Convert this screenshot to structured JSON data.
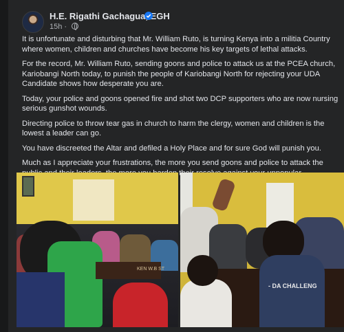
{
  "post": {
    "author": "H.E. Rigathi Gachagua, EGH",
    "time": "15h",
    "paragraphs": [
      "It is unfortunate and disturbing that Mr. William Ruto, is turning Kenya into a militia Country where women, children and churches have become his key targets of lethal attacks.",
      "For the record, Mr. William Ruto, sending goons and police to attack us at the PCEA church, Kariobangi North today, to punish the people of Kariobangi North for rejecting your UDA Candidate shows how desperate you are.",
      "Today, your police and goons opened fire and shot two DCP supporters who are now nursing serious gunshot wounds.",
      "Directing police to throw tear gas in church to harm the clergy, women and children is the lowest a leader can go.",
      "You have discreeted the Altar and defiled a Holy Place and for sure God will punish you.",
      "Much as I appreciate your frustrations, the more you send goons and police to attack the public and their leaders, the more  you harden their resolve against your unpopular leadership."
    ]
  },
  "icons": {
    "verified": "verified-badge-icon",
    "audience": "globe-icon"
  },
  "colors": {
    "background": "#18191a",
    "card": "#242526",
    "text": "#e4e6eb",
    "secondary_text": "#b0b3b8",
    "verified": "#1877f2"
  },
  "photos": {
    "left_shirt_text": "KEN W.B ST",
    "right_shirt_text": "- DA  CHALLENG"
  }
}
